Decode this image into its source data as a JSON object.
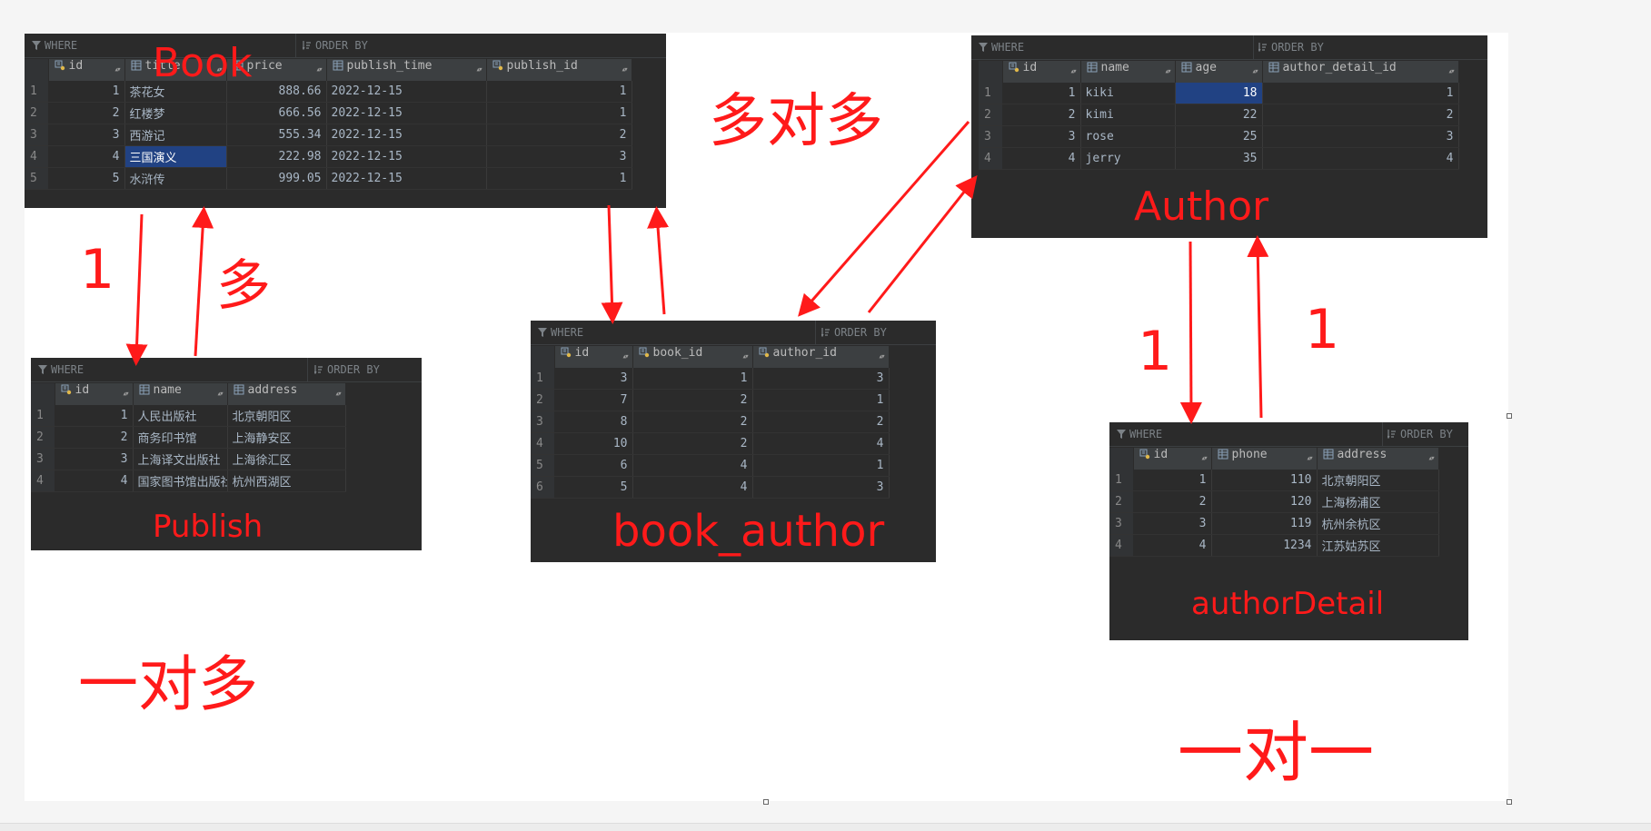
{
  "tables": {
    "book": {
      "label": "Book",
      "where": "WHERE",
      "order_by": "ORDER BY",
      "columns": [
        "id",
        "title",
        "price",
        "publish_time",
        "publish_id"
      ],
      "rows": [
        [
          "1",
          "1",
          "茶花女",
          "888.66",
          "2022-12-15",
          "1"
        ],
        [
          "2",
          "2",
          "红楼梦",
          "666.56",
          "2022-12-15",
          "1"
        ],
        [
          "3",
          "3",
          "西游记",
          "555.34",
          "2022-12-15",
          "2"
        ],
        [
          "4",
          "4",
          "三国演义",
          "222.98",
          "2022-12-15",
          "3"
        ],
        [
          "5",
          "5",
          "水浒传",
          "999.05",
          "2022-12-15",
          "1"
        ]
      ]
    },
    "publish": {
      "label": "Publish",
      "where": "WHERE",
      "order_by": "ORDER BY",
      "columns": [
        "id",
        "name",
        "address"
      ],
      "rows": [
        [
          "1",
          "1",
          "人民出版社",
          "北京朝阳区"
        ],
        [
          "2",
          "2",
          "商务印书馆",
          "上海静安区"
        ],
        [
          "3",
          "3",
          "上海译文出版社",
          "上海徐汇区"
        ],
        [
          "4",
          "4",
          "国家图书馆出版社",
          "杭州西湖区"
        ]
      ]
    },
    "book_author": {
      "label": "book_author",
      "where": "WHERE",
      "order_by": "ORDER BY",
      "columns": [
        "id",
        "book_id",
        "author_id"
      ],
      "rows": [
        [
          "1",
          "3",
          "1",
          "3"
        ],
        [
          "2",
          "7",
          "2",
          "1"
        ],
        [
          "3",
          "8",
          "2",
          "2"
        ],
        [
          "4",
          "10",
          "2",
          "4"
        ],
        [
          "5",
          "6",
          "4",
          "1"
        ],
        [
          "6",
          "5",
          "4",
          "3"
        ]
      ]
    },
    "author": {
      "label": "Author",
      "where": "WHERE",
      "order_by": "ORDER BY",
      "columns": [
        "id",
        "name",
        "age",
        "author_detail_id"
      ],
      "rows": [
        [
          "1",
          "1",
          "kiki",
          "18",
          "1"
        ],
        [
          "2",
          "2",
          "kimi",
          "22",
          "2"
        ],
        [
          "3",
          "3",
          "rose",
          "25",
          "3"
        ],
        [
          "4",
          "4",
          "jerry",
          "35",
          "4"
        ]
      ]
    },
    "author_detail": {
      "label": "authorDetail",
      "where": "WHERE",
      "order_by": "ORDER BY",
      "columns": [
        "id",
        "phone",
        "address"
      ],
      "rows": [
        [
          "1",
          "1",
          "110",
          "北京朝阳区"
        ],
        [
          "2",
          "2",
          "120",
          "上海杨浦区"
        ],
        [
          "3",
          "3",
          "119",
          "杭州余杭区"
        ],
        [
          "4",
          "4",
          "1234",
          "江苏姑苏区"
        ]
      ]
    }
  },
  "annotations": {
    "book_publish_one": "1",
    "book_publish_many": "多",
    "one_to_many": "一对多",
    "many_to_many": "多对多",
    "author_detail_left": "1",
    "author_detail_right": "1",
    "one_to_one": "一对一"
  },
  "colors": {
    "annotation_red": "#ff1a1a",
    "panel_bg": "#2b2b2b",
    "header_bg": "#3c3f41",
    "selection": "#214283",
    "key_icon": "#e0b84a",
    "column_icon": "#8aa0b8"
  }
}
